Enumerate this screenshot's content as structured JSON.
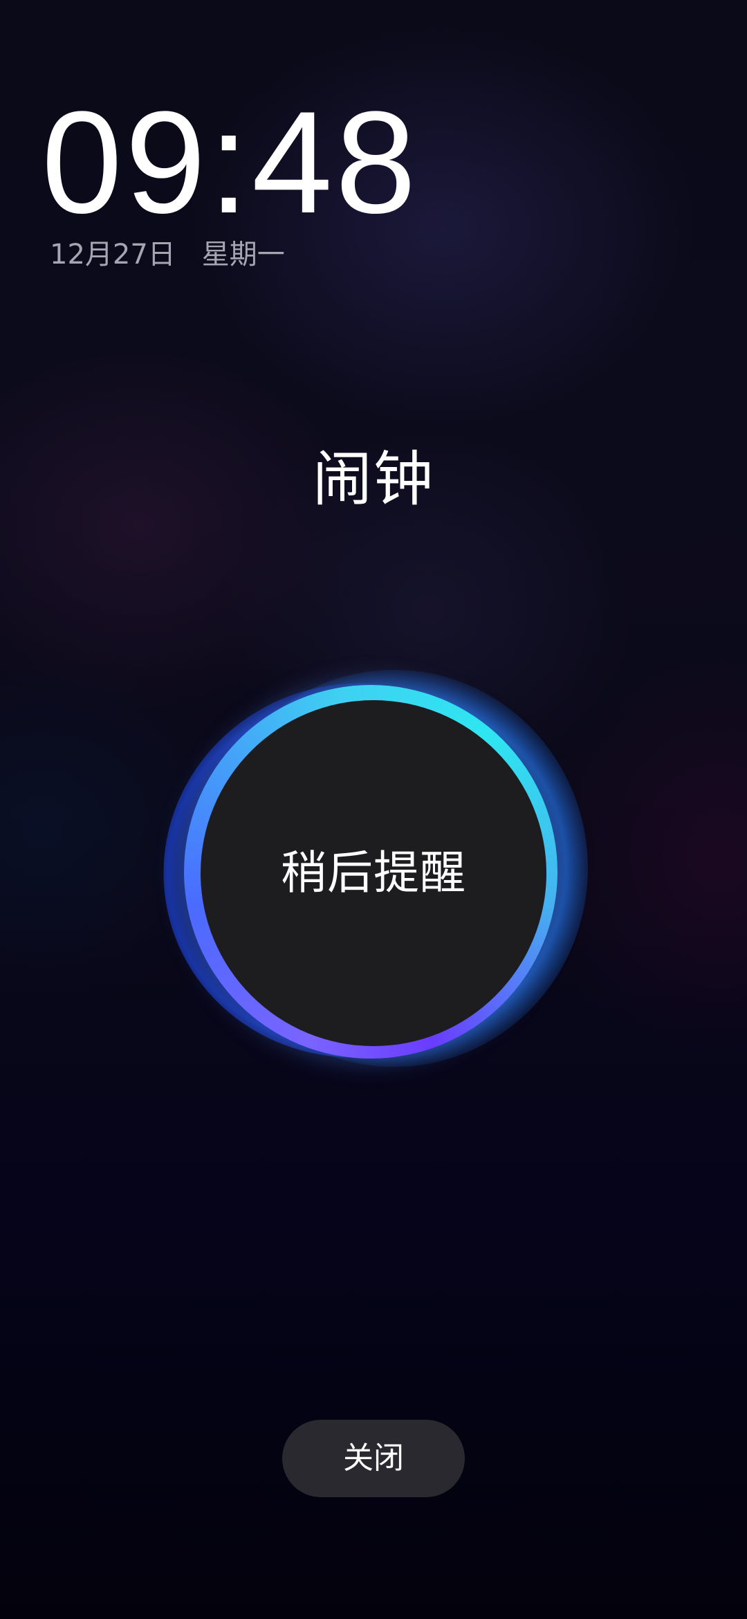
{
  "lockscreen": {
    "time": "09:48",
    "date": "12月27日",
    "weekday": "星期一"
  },
  "alarm": {
    "title": "闹钟",
    "snooze_label": "稍后提醒",
    "close_label": "关闭"
  },
  "colors": {
    "ring_cyan": "#2ee6f0",
    "ring_violet": "#6a3cff",
    "core": "#1d1d1f",
    "close_button": "#29292f",
    "secondary_text": "#a6a6b3"
  }
}
